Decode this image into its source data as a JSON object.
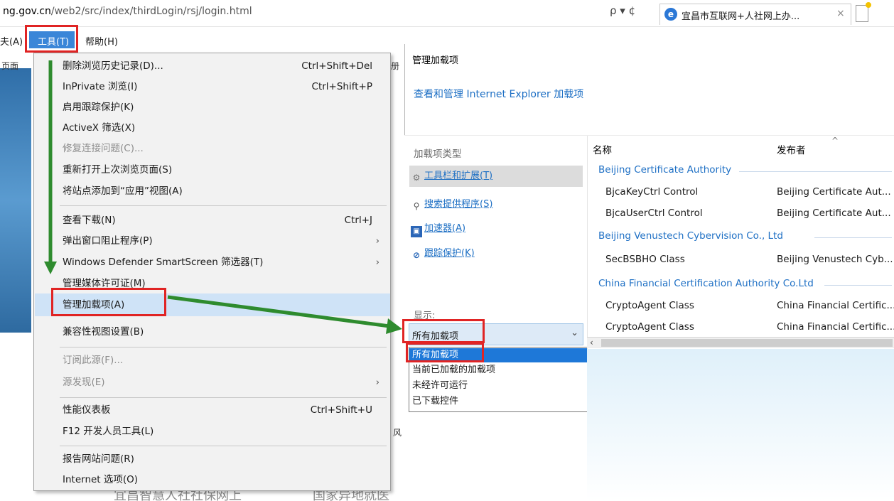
{
  "browser": {
    "url_prefix": "ng.gov.cn",
    "url_rest": "/web2/src/index/thirdLogin/rsj/login.html",
    "url_controls": "ρ ▾ ¢",
    "tab_title": "宜昌市互联网+人社网上办...",
    "tab_close": "×"
  },
  "menubar": {
    "partial_left": "夫(A)",
    "tools": "工具(T)",
    "help": "帮助(H)",
    "page_left": "页面"
  },
  "tools_menu": {
    "items": [
      {
        "label": "删除浏览历史记录(D)...",
        "shortcut": "Ctrl+Shift+Del"
      },
      {
        "label": "InPrivate 浏览(I)",
        "shortcut": "Ctrl+Shift+P"
      },
      {
        "label": "启用跟踪保护(K)",
        "shortcut": ""
      },
      {
        "label": "ActiveX 筛选(X)",
        "shortcut": ""
      },
      {
        "label": "修复连接问题(C)...",
        "shortcut": ""
      },
      {
        "label": "重新打开上次浏览页面(S)",
        "shortcut": ""
      },
      {
        "label": "将站点添加到“应用”视图(A)",
        "shortcut": ""
      },
      {
        "label": "查看下载(N)",
        "shortcut": "Ctrl+J"
      },
      {
        "label": "弹出窗口阻止程序(P)",
        "shortcut": ""
      },
      {
        "label": "Windows Defender SmartScreen 筛选器(T)",
        "shortcut": ""
      },
      {
        "label": "管理媒体许可证(M)",
        "shortcut": ""
      },
      {
        "label": "管理加载项(A)",
        "shortcut": ""
      },
      {
        "label": "兼容性视图设置(B)",
        "shortcut": ""
      },
      {
        "label": "订阅此源(F)...",
        "shortcut": ""
      },
      {
        "label": "源发现(E)",
        "shortcut": ""
      },
      {
        "label": "性能仪表板",
        "shortcut": "Ctrl+Shift+U"
      },
      {
        "label": "F12 开发人员工具(L)",
        "shortcut": ""
      },
      {
        "label": "报告网站问题(R)",
        "shortcut": ""
      },
      {
        "label": "Internet 选项(O)",
        "shortcut": ""
      }
    ],
    "submenu_arrow": "›"
  },
  "addon_dialog": {
    "title": "管理加载项",
    "link": "查看和管理 Internet Explorer 加载项",
    "types_heading": "加载项类型",
    "types": [
      "工具栏和扩展(T)",
      "搜索提供程序(S)",
      "加速器(A)",
      "跟踪保护(K)"
    ],
    "show_label": "显示:",
    "show_selected": "所有加载项",
    "show_options": [
      "所有加载项",
      "当前已加载的加载项",
      "未经许可运行",
      "已下载控件"
    ],
    "col_name": "名称",
    "col_publisher": "发布者",
    "groups": [
      {
        "name": "Beijing Certificate Authority",
        "rows": [
          {
            "name": "BjcaKeyCtrl Control",
            "publisher": "Beijing Certificate Aut..."
          },
          {
            "name": "BjcaUserCtrl Control",
            "publisher": "Beijing Certificate Aut..."
          }
        ]
      },
      {
        "name": "Beijing Venustech Cybervision Co., Ltd",
        "rows": [
          {
            "name": "SecBSBHO Class",
            "publisher": "Beijing Venustech Cyb..."
          }
        ]
      },
      {
        "name": "China Financial Certification Authority Co.Ltd",
        "rows": [
          {
            "name": "CryptoAgent Class",
            "publisher": "China Financial Certific..."
          },
          {
            "name": "CryptoAgent Class",
            "publisher": "China Financial Certific..."
          }
        ]
      }
    ]
  },
  "page_behind": {
    "fragment1": "册",
    "fragment2": "风",
    "fragment3": "宜昌智慧人社社保网上",
    "fragment4": "国家异地就医"
  },
  "colors": {
    "accent": "#3a86d8",
    "highlight_box": "#e02424",
    "arrow": "#2e8b2e",
    "link": "#1d6fc4"
  }
}
